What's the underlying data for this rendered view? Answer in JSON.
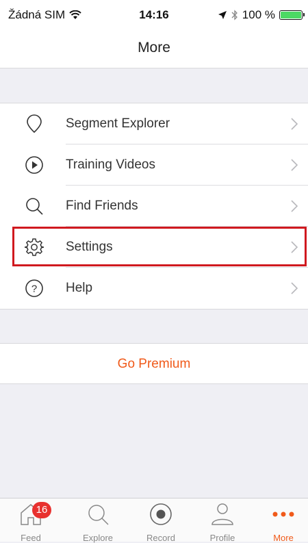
{
  "status_bar": {
    "carrier": "Žádná SIM",
    "time": "14:16",
    "battery": "100 %",
    "wifi_icon": "wifi-icon",
    "location_icon": "location-arrow-icon",
    "bluetooth_icon": "bluetooth-icon"
  },
  "nav": {
    "title": "More"
  },
  "menu": {
    "items": [
      {
        "label": "Segment Explorer",
        "icon": "map-pin-icon"
      },
      {
        "label": "Training Videos",
        "icon": "play-circle-icon"
      },
      {
        "label": "Find Friends",
        "icon": "search-icon"
      },
      {
        "label": "Settings",
        "icon": "gear-icon"
      },
      {
        "label": "Help",
        "icon": "question-circle-icon"
      }
    ]
  },
  "premium": {
    "label": "Go Premium"
  },
  "tabbar": {
    "feed_badge": "16",
    "tabs": [
      {
        "label": "Feed",
        "icon": "home-icon"
      },
      {
        "label": "Explore",
        "icon": "search-icon"
      },
      {
        "label": "Record",
        "icon": "record-icon"
      },
      {
        "label": "Profile",
        "icon": "person-icon"
      },
      {
        "label": "More",
        "icon": "more-dots-icon"
      }
    ]
  },
  "colors": {
    "accent": "#f05a1a",
    "badge": "#e8312f",
    "highlight_border": "#d0191f",
    "background": "#efeff4"
  }
}
